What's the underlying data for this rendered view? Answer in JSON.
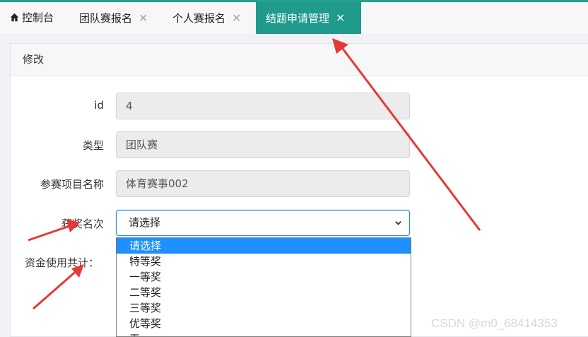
{
  "tabs": [
    {
      "label": "控制台",
      "icon": "home-icon",
      "closable": false
    },
    {
      "label": "团队赛报名",
      "closable": true
    },
    {
      "label": "个人赛报名",
      "closable": true
    },
    {
      "label": "结题申请管理",
      "closable": true,
      "active": true
    }
  ],
  "close_glyph": "✕",
  "panel": {
    "title": "修改"
  },
  "form": {
    "id": {
      "label": "id",
      "value": "4"
    },
    "type": {
      "label": "类型",
      "value": "团队赛"
    },
    "project_name": {
      "label": "参赛项目名称",
      "value": "体育赛事002"
    },
    "award_rank": {
      "label": "获奖名次",
      "value": "请选择"
    },
    "funds_total": {
      "label": "资金使用共计："
    }
  },
  "dropdown_options": [
    "请选择",
    "特等奖",
    "一等奖",
    "二等奖",
    "三等奖",
    "优等奖",
    "无"
  ],
  "watermark": "CSDN @m0_68414353",
  "colors": {
    "tab_active": "#1f9a8c",
    "focus_border": "#1e88e5",
    "option_selected": "#1e90ff",
    "arrow": "#e53935"
  }
}
